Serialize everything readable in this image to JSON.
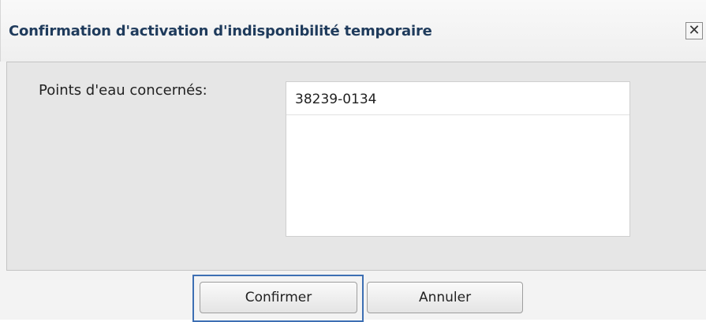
{
  "dialog": {
    "title": "Confirmation d'activation d'indisponibilité temporaire",
    "close_symbol": "✕",
    "close_icon": "close-icon"
  },
  "form": {
    "label": "Points d'eau concernés:",
    "items": [
      {
        "value": "38239-0134"
      }
    ]
  },
  "footer": {
    "confirm_label": "Confirmer",
    "cancel_label": "Annuler",
    "focused_button": "confirm"
  },
  "colors": {
    "title_text": "#1f3b5c",
    "focus_ring": "#3d6fb3",
    "panel_bg": "#e6e6e6",
    "dialog_bg": "#f3f3f3"
  }
}
